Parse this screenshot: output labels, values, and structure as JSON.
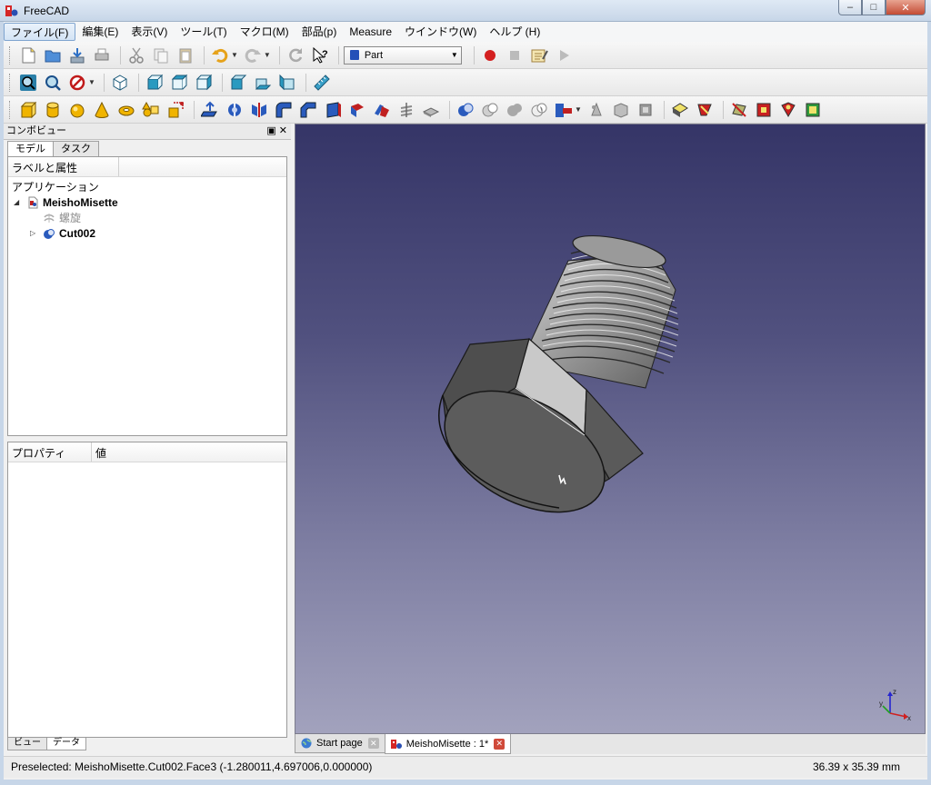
{
  "window": {
    "title": "FreeCAD",
    "min": "–",
    "max": "□",
    "close": "✕"
  },
  "menu": [
    "ファイル(F)",
    "編集(E)",
    "表示(V)",
    "ツール(T)",
    "マクロ(M)",
    "部品(p)",
    "Measure",
    "ウインドウ(W)",
    "ヘルプ (H)"
  ],
  "workbench": {
    "selected": "Part"
  },
  "combo": {
    "title": "コンボビュー",
    "controls": "▣ ✕",
    "tabs": [
      "モデル",
      "タスク"
    ],
    "tree_header": "ラベルと属性",
    "tree_root": "アプリケーション",
    "document": "MeishoMisette",
    "hidden_item": "螺旋",
    "object": "Cut002",
    "prop_headers": [
      "プロパティ",
      "値"
    ],
    "bottom_tabs": [
      "ビュー",
      "データ"
    ]
  },
  "doc_tabs": [
    {
      "label": "Start page"
    },
    {
      "label": "MeishoMisette : 1*"
    }
  ],
  "status": {
    "preselected": "Preselected: MeishoMisette.Cut002.Face3 (-1.280011,4.697006,0.000000)",
    "dimensions": "36.39 x 35.39 mm"
  },
  "axis_labels": {
    "x": "x",
    "y": "y",
    "z": "z"
  },
  "colors": {
    "viewport_top": "#353567",
    "viewport_bottom": "#a2a2bd",
    "record": "#d42020",
    "bolt": "#8c8c8c"
  }
}
